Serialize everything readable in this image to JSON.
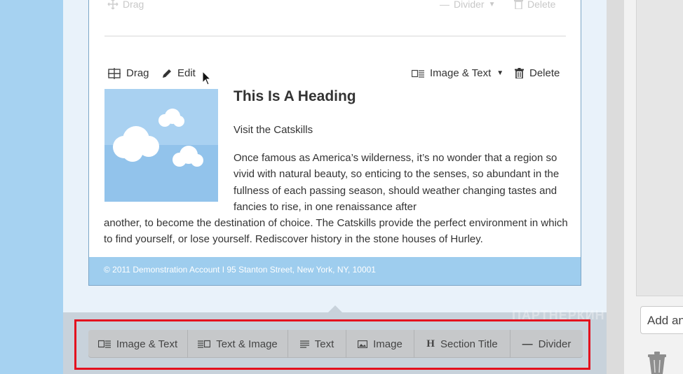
{
  "top_row": {
    "drag_label": "Drag",
    "divider_label": "Divider",
    "delete_label": "Delete"
  },
  "block": {
    "drag_label": "Drag",
    "edit_label": "Edit",
    "type_label": "Image & Text",
    "delete_label": "Delete",
    "heading": "This Is A Heading",
    "subheading": "Visit the Catskills",
    "paragraph_wrap": "Once famous as America’s wilderness, it’s no wonder that a region so vivid with natural beauty, so enticing to the senses, so abundant in the fullness of each passing season, should weather changing tastes and fancies to rise, in one renaissance after",
    "paragraph_full": "another, to become the destination of choice. The Catskills provide the perfect environment in which to find yourself, or lose yourself. Rediscover history in the stone houses of Hurley."
  },
  "footer": {
    "text": "© 2011 Demonstration Account I 95 Stanton Street, New York, NY, 10001"
  },
  "toolbar": {
    "buttons": [
      {
        "label": "Image & Text",
        "icon": "image-text-icon"
      },
      {
        "label": "Text & Image",
        "icon": "text-image-icon"
      },
      {
        "label": "Text",
        "icon": "text-lines-icon"
      },
      {
        "label": "Image",
        "icon": "image-icon"
      },
      {
        "label": "Section Title",
        "icon": "heading-h-icon"
      },
      {
        "label": "Divider",
        "icon": "minus-icon"
      }
    ]
  },
  "right_panel": {
    "add_placeholder": "Add an"
  },
  "watermark": {
    "text": "ПАРТНЕРКИН"
  },
  "colors": {
    "accent_blue": "#9ecdee",
    "highlight_red": "#e3101e"
  }
}
